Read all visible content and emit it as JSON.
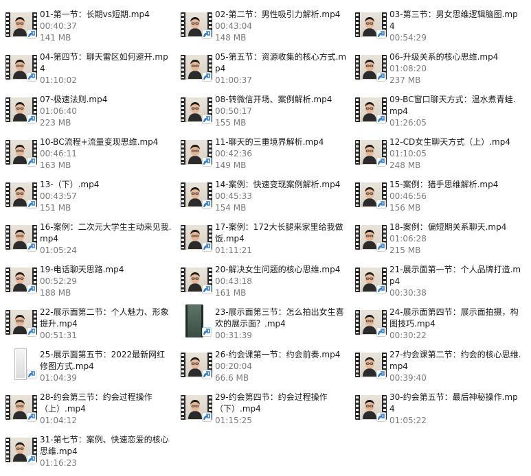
{
  "files": [
    {
      "name": "01-第一节：长期vs短期.mp4",
      "duration": "00:40:37",
      "size": "141 MB",
      "thumb": "person"
    },
    {
      "name": "02-第二节：男性吸引力解析.mp4",
      "duration": "00:43:04",
      "size": "148 MB",
      "thumb": "person"
    },
    {
      "name": "03-第三节：男女思维逻辑脑图.mp4",
      "duration": "00:54:29",
      "size": "",
      "thumb": "person"
    },
    {
      "name": "04-第四节：聊天雷区如何避开.mp4",
      "duration": "01:10:02",
      "size": "",
      "thumb": "person"
    },
    {
      "name": "05-第五节：资源收集的核心方式.mp4",
      "duration": "01:00:37",
      "size": "",
      "thumb": "person"
    },
    {
      "name": "06-升级关系的核心思维.mp4",
      "duration": "01:08:20",
      "size": "237 MB",
      "thumb": "person"
    },
    {
      "name": "07-极速法则.mp4",
      "duration": "01:06:40",
      "size": "223 MB",
      "thumb": "person"
    },
    {
      "name": "08-转微信开场、案例解析.mp4",
      "duration": "00:50:17",
      "size": "155 MB",
      "thumb": "person"
    },
    {
      "name": "09-BC窗口聊天方式：温水煮青蛙.mp4",
      "duration": "01:26:05",
      "size": "",
      "thumb": "person"
    },
    {
      "name": "10-BC流程+流量变现思维.mp4",
      "duration": "00:46:11",
      "size": "163 MB",
      "thumb": "person"
    },
    {
      "name": "11-聊天的三重境界解析.mp4",
      "duration": "00:42:36",
      "size": "149 MB",
      "thumb": "person"
    },
    {
      "name": "12-CD女生聊天方式（上）.mp4",
      "duration": "01:10:05",
      "size": "248 MB",
      "thumb": "person"
    },
    {
      "name": "13-（下）.mp4",
      "duration": "00:43:57",
      "size": "151 MB",
      "thumb": "person"
    },
    {
      "name": "14-案例：快速变现案例解析.mp4",
      "duration": "00:45:33",
      "size": "154 MB",
      "thumb": "person"
    },
    {
      "name": "15-案例：猎手思维解析.mp4",
      "duration": "00:46:56",
      "size": "156 MB",
      "thumb": "person"
    },
    {
      "name": "16-案例：二次元大学生主动来见我.mp4",
      "duration": "01:05:24",
      "size": "",
      "thumb": "person"
    },
    {
      "name": "17-案例：172大长腿来家里给我做饭.mp4",
      "duration": "01:11:21",
      "size": "",
      "thumb": "person"
    },
    {
      "name": "18-案例：偏短期关系聊天.mp4",
      "duration": "01:06:28",
      "size": "215 MB",
      "thumb": "person"
    },
    {
      "name": "19-电话聊天思路.mp4",
      "duration": "00:52:29",
      "size": "188 MB",
      "thumb": "person"
    },
    {
      "name": "20-解决女生问题的核心思维.mp4",
      "duration": "00:43:18",
      "size": "161 MB",
      "thumb": "person"
    },
    {
      "name": "21-展示面第一节：个人品牌打造.mp4",
      "duration": "00:30:38",
      "size": "",
      "thumb": "person"
    },
    {
      "name": "22-展示面第二节：个人魅力、形象提升.mp4",
      "duration": "00:51:31",
      "size": "",
      "thumb": "person"
    },
    {
      "name": "23-展示面第三节：怎么拍出女生喜欢的展示面？.mp4",
      "duration": "00:31:39",
      "size": "",
      "thumb": "phone"
    },
    {
      "name": "24-展示面第四节：展示面拍摄，构图技巧.mp4",
      "duration": "00:30:22",
      "size": "",
      "thumb": "person"
    },
    {
      "name": "25-展示面第五节：2022最新网红修图方式.mp4",
      "duration": "01:04:39",
      "size": "",
      "thumb": "vertical"
    },
    {
      "name": "26-约会课第一节：约会前奏.mp4",
      "duration": "00:20:04",
      "size": "66.6 MB",
      "thumb": "person"
    },
    {
      "name": "27-约会课第二节：约会的核心思维.mp4",
      "duration": "00:39:40",
      "size": "",
      "thumb": "person"
    },
    {
      "name": "28-约会第三节：约会过程操作（上）.mp4",
      "duration": "01:04:12",
      "size": "",
      "thumb": "person"
    },
    {
      "name": "29-约会第四节：约会过程操作（下）.mp4",
      "duration": "01:15:25",
      "size": "",
      "thumb": "person"
    },
    {
      "name": "30-约会第五节：最后神秘操作.mp4",
      "duration": "01:05:22",
      "size": "",
      "thumb": "person"
    },
    {
      "name": "31-第七节：案例、快速恋爱的核心思维.mp4",
      "duration": "01:16:23",
      "size": "",
      "thumb": "person"
    }
  ],
  "colors": {
    "text": "#1a1a1a",
    "meta": "#7a7a7a",
    "badge": "#2f7ed8"
  }
}
